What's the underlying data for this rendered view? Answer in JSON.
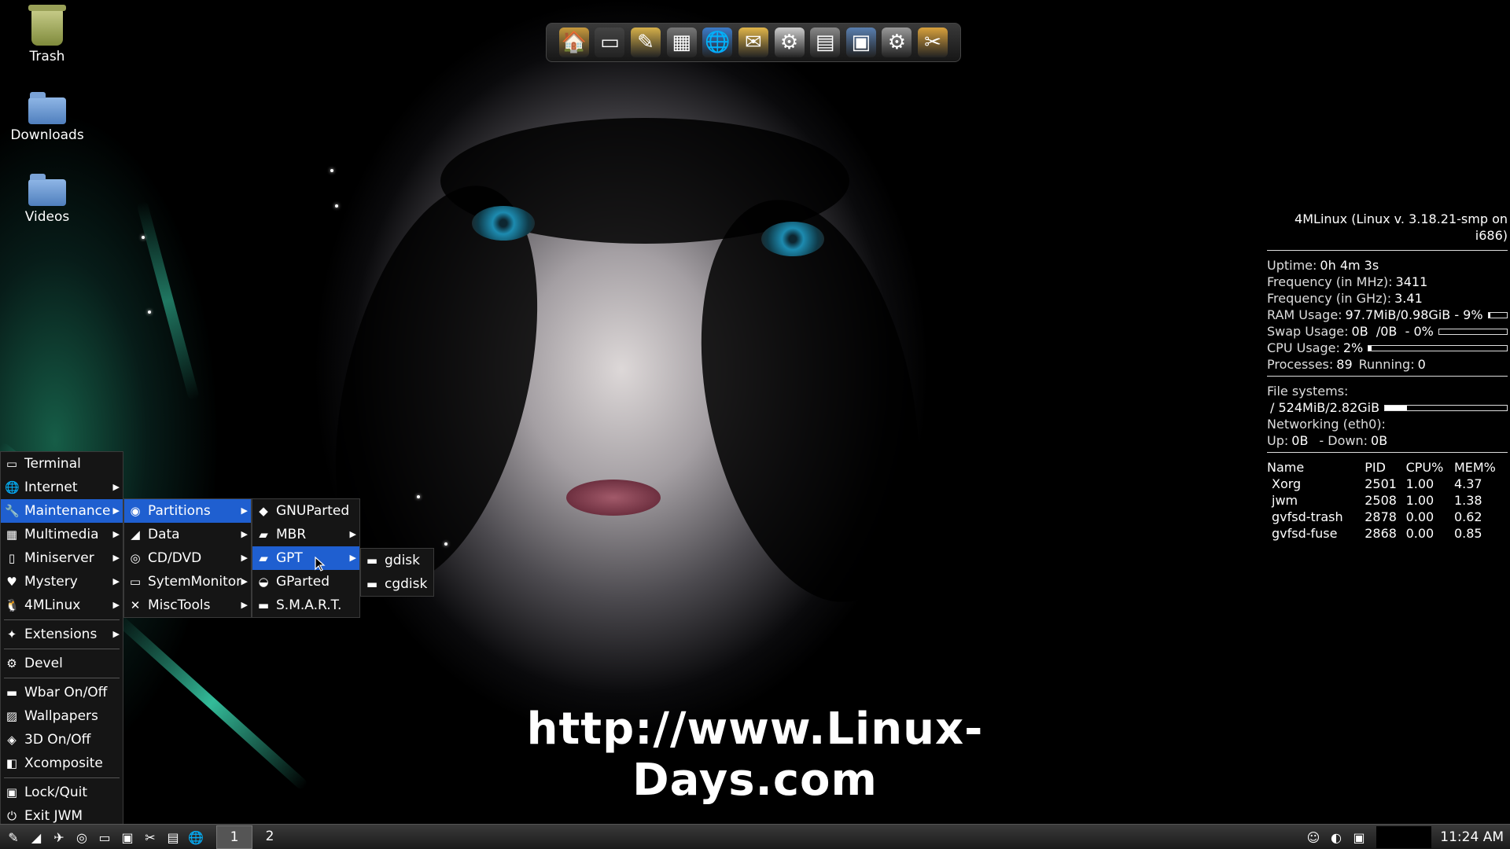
{
  "desktop_icons": [
    {
      "name": "trash",
      "label": "Trash"
    },
    {
      "name": "downloads",
      "label": "Downloads"
    },
    {
      "name": "videos",
      "label": "Videos"
    }
  ],
  "dock": [
    {
      "name": "home-icon",
      "glyph": "🏠",
      "color": "#c89a3c"
    },
    {
      "name": "terminal-icon",
      "glyph": "▭",
      "color": "#444"
    },
    {
      "name": "text-editor-icon",
      "glyph": "✎",
      "color": "#d6b04a"
    },
    {
      "name": "calculator-icon",
      "glyph": "▦",
      "color": "#777"
    },
    {
      "name": "browser-icon",
      "glyph": "🌐",
      "color": "#3d7bc8"
    },
    {
      "name": "mail-icon",
      "glyph": "✉",
      "color": "#e2b64a"
    },
    {
      "name": "video-player-icon",
      "glyph": "⚙",
      "color": "#ccc"
    },
    {
      "name": "printer-icon",
      "glyph": "▤",
      "color": "#888"
    },
    {
      "name": "file-manager-icon",
      "glyph": "▣",
      "color": "#5a7fb0"
    },
    {
      "name": "settings-icon",
      "glyph": "⚙",
      "color": "#999"
    },
    {
      "name": "tools-icon",
      "glyph": "✂",
      "color": "#d9a13c"
    }
  ],
  "watermark": "http://www.Linux-Days.com",
  "conky": {
    "header": "4MLinux (Linux v. 3.18.21-smp on i686)",
    "uptime_label": "Uptime:",
    "uptime": "0h 4m 3s",
    "freq_mhz_label": "Frequency (in MHz):",
    "freq_mhz": "3411",
    "freq_ghz_label": "Frequency (in GHz):",
    "freq_ghz": "3.41",
    "ram_label": "RAM Usage:",
    "ram": "97.7MiB/0.98GiB - 9%",
    "ram_pct": 0.09,
    "swap_label": "Swap Usage:",
    "swap": "0B  /0B  - 0%",
    "swap_pct": 0.0,
    "cpu_label": "CPU Usage:",
    "cpu": "2%",
    "cpu_pct": 0.02,
    "proc_label": "Processes:",
    "proc": "89",
    "running_label": "Running:",
    "running": "0",
    "fs_label": "File systems:",
    "fs_root": "/ 524MiB/2.82GiB",
    "fs_pct": 0.18,
    "net_label": "Networking (eth0):",
    "up_label": "Up:",
    "up": "0B",
    "down_label": "- Down:",
    "down": "0B",
    "ptable_header": [
      "Name",
      "PID",
      "CPU%",
      "MEM%"
    ],
    "processes": [
      [
        "Xorg",
        "2501",
        "1.00",
        "4.37"
      ],
      [
        "jwm",
        "2508",
        "1.00",
        "1.38"
      ],
      [
        "gvfsd-trash",
        "2878",
        "0.00",
        "0.62"
      ],
      [
        "gvfsd-fuse",
        "2868",
        "0.00",
        "0.85"
      ]
    ]
  },
  "menu_main": [
    {
      "name": "menu-terminal",
      "label": "Terminal",
      "icon": "terminal-icon",
      "glyph": "▭",
      "sub": false
    },
    {
      "name": "menu-internet",
      "label": "Internet",
      "icon": "globe-icon",
      "glyph": "🌐",
      "sub": true
    },
    {
      "name": "menu-maintenance",
      "label": "Maintenance",
      "icon": "wrench-icon",
      "glyph": "🔧",
      "sub": true,
      "selected": true
    },
    {
      "name": "menu-multimedia",
      "label": "Multimedia",
      "icon": "film-icon",
      "glyph": "▦",
      "sub": true
    },
    {
      "name": "menu-miniserver",
      "label": "Miniserver",
      "icon": "server-icon",
      "glyph": "▯",
      "sub": true
    },
    {
      "name": "menu-mystery",
      "label": "Mystery",
      "icon": "cards-icon",
      "glyph": "♥",
      "sub": true
    },
    {
      "name": "menu-4mlinux",
      "label": "4MLinux",
      "icon": "penguin-icon",
      "glyph": "🐧",
      "sub": true
    },
    {
      "sep": true
    },
    {
      "name": "menu-extensions",
      "label": "Extensions",
      "icon": "puzzle-icon",
      "glyph": "✦",
      "sub": true
    },
    {
      "sep": true
    },
    {
      "name": "menu-devel",
      "label": "Devel",
      "icon": "gear-icon",
      "glyph": "⚙",
      "sub": false
    },
    {
      "sep": true
    },
    {
      "name": "menu-wbar",
      "label": "Wbar On/Off",
      "icon": "bar-icon",
      "glyph": "▬",
      "sub": false
    },
    {
      "name": "menu-wallpapers",
      "label": "Wallpapers",
      "icon": "image-icon",
      "glyph": "▨",
      "sub": false
    },
    {
      "name": "menu-3d",
      "label": "3D On/Off",
      "icon": "cube-icon",
      "glyph": "◈",
      "sub": false
    },
    {
      "name": "menu-xcomposite",
      "label": "Xcomposite",
      "icon": "window-icon",
      "glyph": "◧",
      "sub": false
    },
    {
      "sep": true
    },
    {
      "name": "menu-lockquit",
      "label": "Lock/Quit",
      "icon": "lock-icon",
      "glyph": "▣",
      "sub": false
    },
    {
      "name": "menu-exit",
      "label": "Exit JWM",
      "icon": "exit-icon",
      "glyph": "⏻",
      "sub": false
    }
  ],
  "menu_maint": [
    {
      "name": "menu-partitions",
      "label": "Partitions",
      "icon": "disk-icon",
      "glyph": "◉",
      "sub": true,
      "selected": true
    },
    {
      "name": "menu-data",
      "label": "Data",
      "icon": "drive-icon",
      "glyph": "◢",
      "sub": true
    },
    {
      "name": "menu-cddvd",
      "label": "CD/DVD",
      "icon": "cd-icon",
      "glyph": "◎",
      "sub": true
    },
    {
      "name": "menu-sytemmonitor",
      "label": "SytemMonitor",
      "icon": "monitor-icon",
      "glyph": "▭",
      "sub": true
    },
    {
      "name": "menu-misctools",
      "label": "MiscTools",
      "icon": "tools-icon",
      "glyph": "✕",
      "sub": true
    }
  ],
  "menu_part": [
    {
      "name": "menu-gnuparted",
      "label": "GNUParted",
      "icon": "gnu-icon",
      "glyph": "◆",
      "sub": false
    },
    {
      "name": "menu-mbr",
      "label": "MBR",
      "icon": "folder-icon",
      "glyph": "▰",
      "sub": true
    },
    {
      "name": "menu-gpt",
      "label": "GPT",
      "icon": "folder-icon",
      "glyph": "▰",
      "sub": true,
      "selected": true
    },
    {
      "name": "menu-gparted",
      "label": "GParted",
      "icon": "gparted-icon",
      "glyph": "◒",
      "sub": false
    },
    {
      "name": "menu-smart",
      "label": "S.M.A.R.T.",
      "icon": "harddisk-icon",
      "glyph": "▬",
      "sub": false
    }
  ],
  "menu_gpt": [
    {
      "name": "menu-gdisk",
      "label": "gdisk",
      "icon": "harddisk-icon",
      "glyph": "▬",
      "sub": false
    },
    {
      "name": "menu-cgdisk",
      "label": "cgdisk",
      "icon": "harddisk-icon",
      "glyph": "▬",
      "sub": false
    }
  ],
  "taskbar": {
    "icons": [
      {
        "name": "start-menu-icon",
        "glyph": "✎"
      },
      {
        "name": "drive-icon",
        "glyph": "◢"
      },
      {
        "name": "network-icon",
        "glyph": "✈"
      },
      {
        "name": "media-icon",
        "glyph": "◎"
      },
      {
        "name": "screen-icon",
        "glyph": "▭"
      },
      {
        "name": "files-icon",
        "glyph": "▣"
      },
      {
        "name": "tools-icon",
        "glyph": "✂"
      },
      {
        "name": "keyboard-icon",
        "glyph": "▤"
      },
      {
        "name": "browser-icon",
        "glyph": "🌐"
      }
    ],
    "workspaces": [
      "1",
      "2"
    ],
    "tray": [
      {
        "name": "user-icon",
        "glyph": "☺"
      },
      {
        "name": "volume-icon",
        "glyph": "◐"
      },
      {
        "name": "network-tray-icon",
        "glyph": "▣"
      }
    ],
    "clock": "11:24 AM"
  }
}
